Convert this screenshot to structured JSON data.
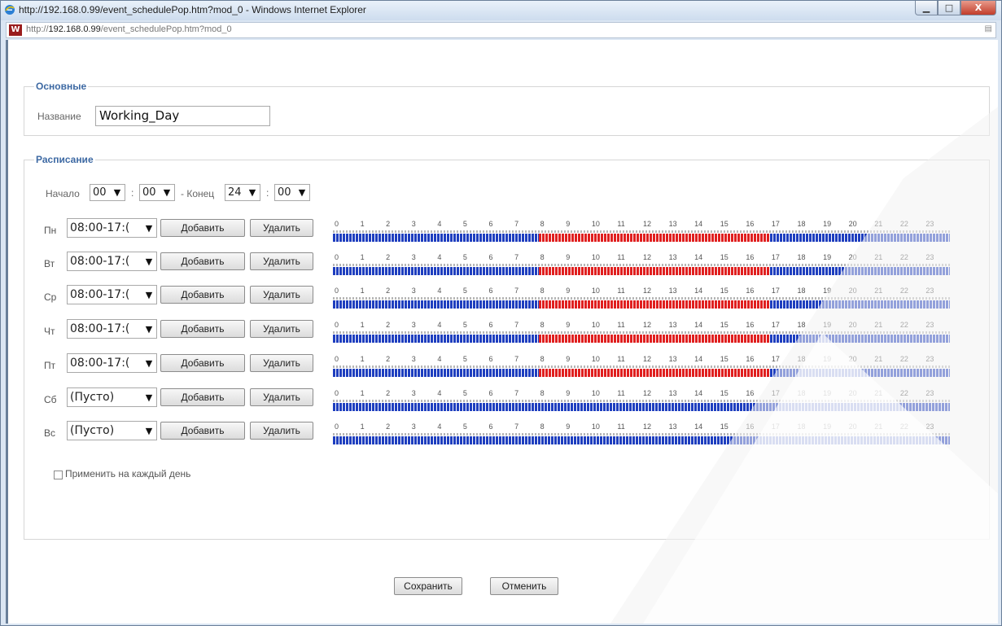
{
  "window": {
    "title": "http://192.168.0.99/event_schedulePop.htm?mod_0 - Windows Internet Explorer",
    "min_glyph": "▁",
    "max_glyph": "□",
    "close_glyph": "X"
  },
  "address": {
    "prefix": "http://",
    "host": "192.168.0.99",
    "path": "/event_schedulePop.htm?mod_0",
    "logo_glyph": "W",
    "page_icon_glyph": "▤"
  },
  "basic": {
    "legend": "Основные",
    "name_label": "Название",
    "name_value": "Working_Day"
  },
  "schedule": {
    "legend": "Расписание",
    "start_label": "Начало",
    "start_hour": "00",
    "colon": ":",
    "start_min": "00",
    "end_label": "- Конец",
    "end_hour": "24",
    "end_min": "00",
    "add_label": "Добавить",
    "delete_label": "Удалить",
    "hour_ticks": [
      "0",
      "1",
      "2",
      "3",
      "4",
      "5",
      "6",
      "7",
      "8",
      "9",
      "10",
      "11",
      "12",
      "13",
      "14",
      "15",
      "16",
      "17",
      "18",
      "19",
      "20",
      "21",
      "22",
      "23"
    ],
    "days": [
      {
        "label": "Пн",
        "interval": "08:00-17:(",
        "active_from": 8,
        "active_to": 17
      },
      {
        "label": "Вт",
        "interval": "08:00-17:(",
        "active_from": 8,
        "active_to": 17
      },
      {
        "label": "Ср",
        "interval": "08:00-17:(",
        "active_from": 8,
        "active_to": 17
      },
      {
        "label": "Чт",
        "interval": "08:00-17:(",
        "active_from": 8,
        "active_to": 17
      },
      {
        "label": "Пт",
        "interval": "08:00-17:(",
        "active_from": 8,
        "active_to": 17
      },
      {
        "label": "Сб",
        "interval": "(Пусто)",
        "active_from": null,
        "active_to": null
      },
      {
        "label": "Вс",
        "interval": "(Пусто)",
        "active_from": null,
        "active_to": null
      }
    ],
    "apply_every_day": "Применить на каждый день",
    "apply_every_day_checked": false
  },
  "footer": {
    "save_label": "Сохранить",
    "cancel_label": "Отменить"
  },
  "colors": {
    "inactive": "#1f3fbf",
    "active": "#e02020",
    "legend": "#3d69a3"
  },
  "icons": {
    "chevron": "chevron-down-icon"
  }
}
